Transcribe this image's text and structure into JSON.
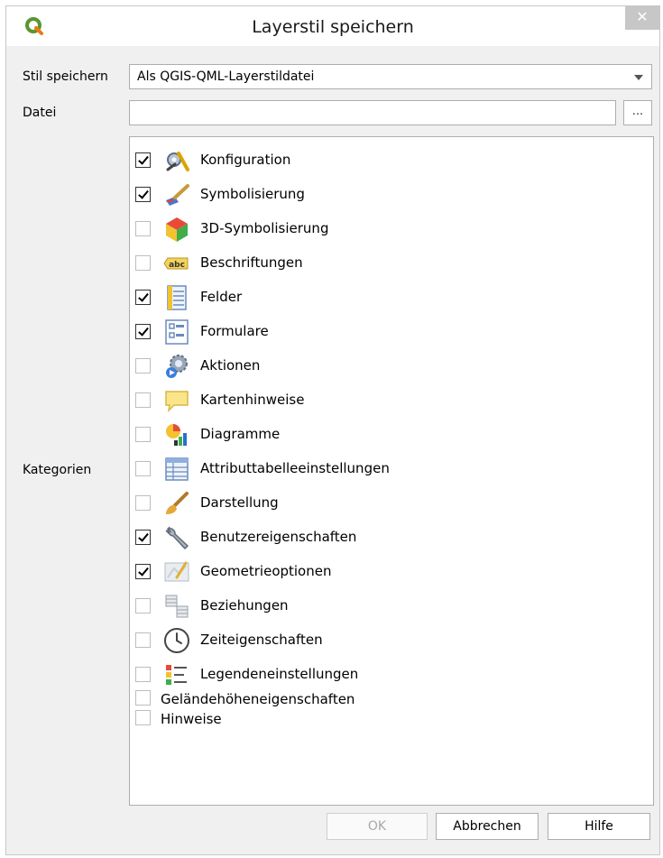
{
  "window": {
    "title": "Layerstil speichern",
    "close_glyph": "✕",
    "app_icon": "qgis-logo-icon"
  },
  "form": {
    "style_label": "Stil speichern",
    "style_value": "Als QGIS-QML-Layerstildatei",
    "file_label": "Datei",
    "file_value": "",
    "browse_label": "...",
    "categories_label": "Kategorien"
  },
  "categories": [
    {
      "label": "Konfiguration",
      "checked": true,
      "icon": "settings-tools-icon"
    },
    {
      "label": "Symbolisierung",
      "checked": true,
      "icon": "paintbrush-icon"
    },
    {
      "label": "3D-Symbolisierung",
      "checked": false,
      "icon": "cube-3d-icon"
    },
    {
      "label": "Beschriftungen",
      "checked": false,
      "icon": "label-abc-icon"
    },
    {
      "label": "Felder",
      "checked": true,
      "icon": "fields-icon"
    },
    {
      "label": "Formulare",
      "checked": true,
      "icon": "form-icon"
    },
    {
      "label": "Aktionen",
      "checked": false,
      "icon": "action-gear-icon"
    },
    {
      "label": "Kartenhinweise",
      "checked": false,
      "icon": "map-tip-icon"
    },
    {
      "label": "Diagramme",
      "checked": false,
      "icon": "diagram-icon"
    },
    {
      "label": "Attributtabelleeinstellungen",
      "checked": false,
      "icon": "attribute-table-icon"
    },
    {
      "label": "Darstellung",
      "checked": false,
      "icon": "rendering-brush-icon"
    },
    {
      "label": "Benutzereigenschaften",
      "checked": true,
      "icon": "wrench-icon"
    },
    {
      "label": "Geometrieoptionen",
      "checked": true,
      "icon": "geometry-icon"
    },
    {
      "label": "Beziehungen",
      "checked": false,
      "icon": "relations-icon"
    },
    {
      "label": "Zeiteigenschaften",
      "checked": false,
      "icon": "clock-icon"
    },
    {
      "label": "Legendeneinstellungen",
      "checked": false,
      "icon": "legend-icon"
    },
    {
      "label": "Geländehöheneigenschaften",
      "checked": false,
      "icon": ""
    },
    {
      "label": "Hinweise",
      "checked": false,
      "icon": ""
    }
  ],
  "buttons": {
    "ok": "OK",
    "cancel": "Abbrechen",
    "help": "Hilfe"
  },
  "colors": {
    "qgis_green": "#589632",
    "qgis_yellow": "#ee7913",
    "checkbox_border": "#bdbdbd"
  }
}
